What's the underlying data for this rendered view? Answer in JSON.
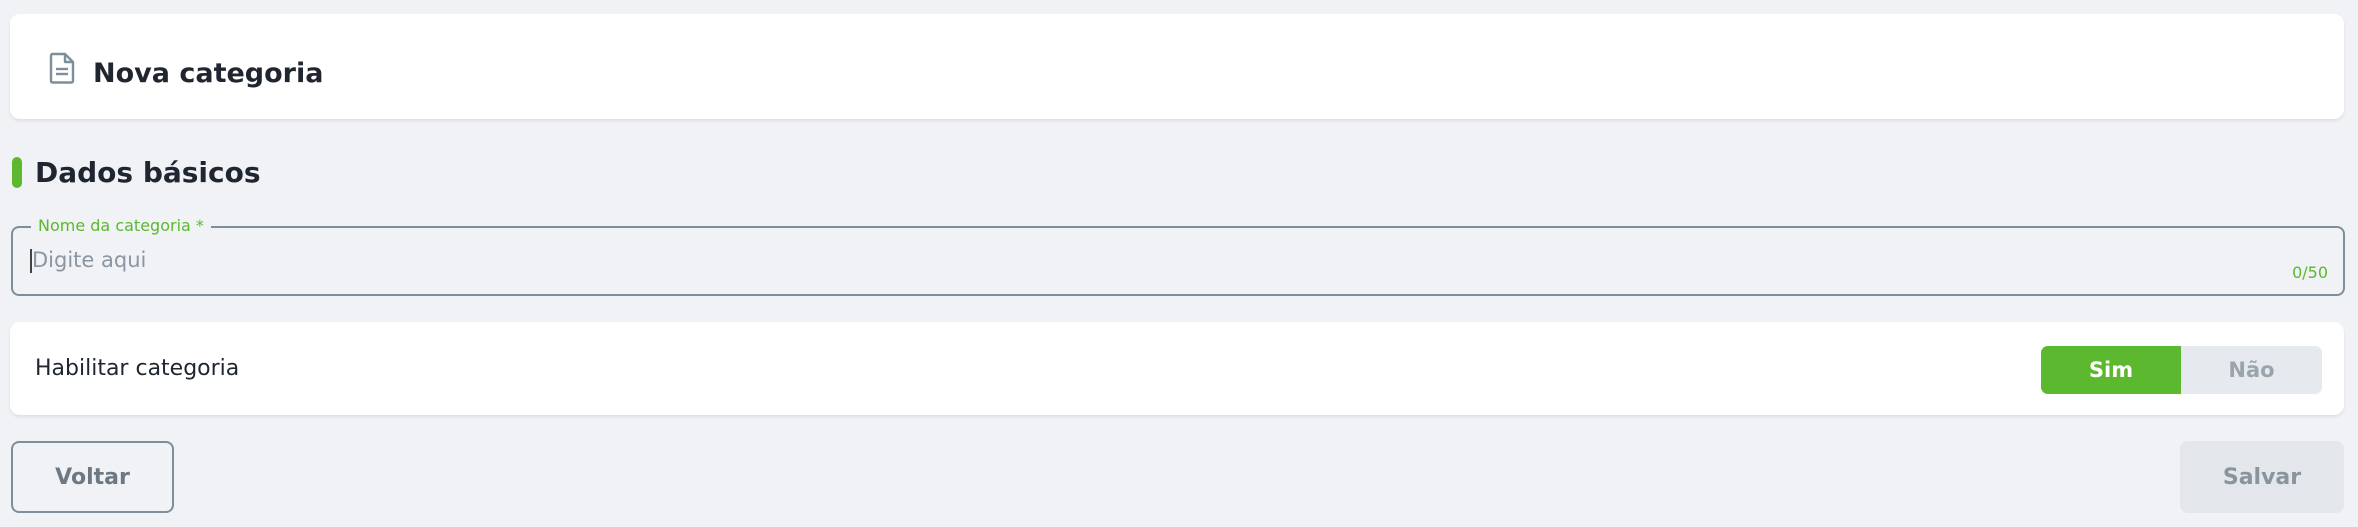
{
  "header": {
    "icon": "document-icon",
    "title": "Nova categoria"
  },
  "section": {
    "title": "Dados básicos",
    "accent_color": "#5cb82e"
  },
  "name_field": {
    "label": "Nome da categoria *",
    "placeholder": "Digite aqui",
    "value": "",
    "counter": "0/50"
  },
  "enable_toggle": {
    "label": "Habilitar categoria",
    "options": [
      "Sim",
      "Não"
    ],
    "selected": "Sim"
  },
  "actions": {
    "back_label": "Voltar",
    "save_label": "Salvar"
  },
  "colors": {
    "accent": "#5cb82e",
    "background": "#f0f2f6",
    "border": "#7e8f9c",
    "disabled": "#e3e7eb"
  }
}
